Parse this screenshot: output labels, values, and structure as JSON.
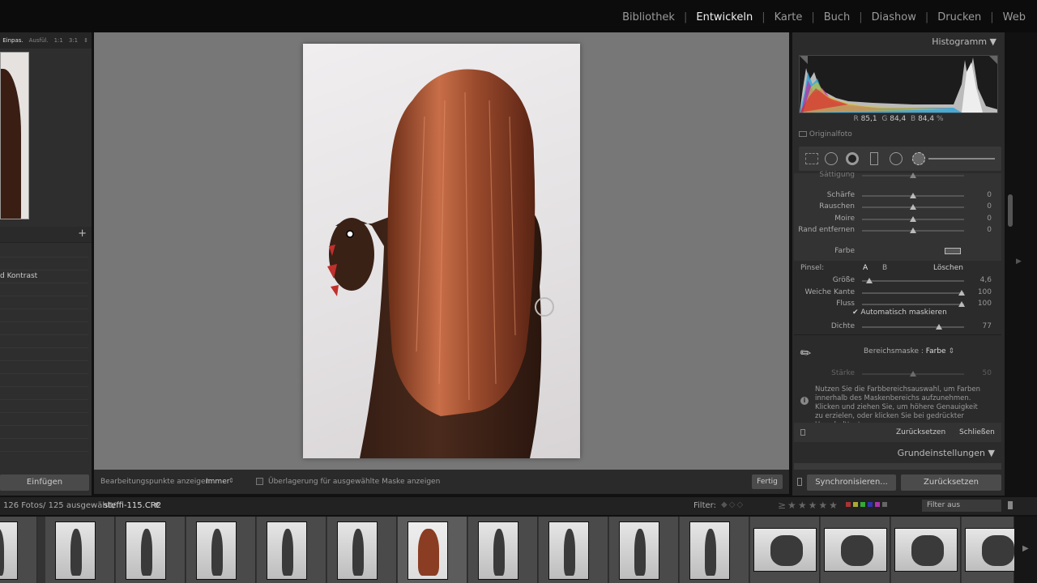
{
  "modules": [
    "Bibliothek",
    "Entwickeln",
    "Karte",
    "Buch",
    "Diashow",
    "Drucken",
    "Web"
  ],
  "active_module": "Entwickeln",
  "navigator": {
    "zoom_options": [
      "Einpas.",
      "Ausfül.",
      "1:1",
      "3:1"
    ]
  },
  "presets": {
    "items": [
      "d Kontrast"
    ]
  },
  "left_buttons": {
    "paste": "Einfügen"
  },
  "toolbar": {
    "edit_points_label": "Bearbeitungspunkte anzeigen:",
    "edit_points_value": "Immer",
    "overlay_label": "Überlagerung für ausgewählte Maske anzeigen",
    "done": "Fertig"
  },
  "histogram": {
    "title": "Histogramm",
    "r_label": "R",
    "r": "85,1",
    "g_label": "G",
    "g": "84,4",
    "b_label": "B",
    "b": "84,4",
    "unit": "%",
    "original": "Originalfoto"
  },
  "adjust": {
    "top_cut": "Sättigung",
    "rows": [
      {
        "label": "Schärfe",
        "value": "0"
      },
      {
        "label": "Rauschen",
        "value": "0"
      },
      {
        "label": "Moire",
        "value": "0"
      },
      {
        "label": "Rand entfernen",
        "value": "0"
      }
    ],
    "farbe": "Farbe"
  },
  "brush": {
    "label": "Pinsel:",
    "a": "A",
    "b": "B",
    "clear": "Löschen",
    "rows": [
      {
        "label": "Größe",
        "value": "4,6"
      },
      {
        "label": "Weiche Kante",
        "value": "100"
      },
      {
        "label": "Fluss",
        "value": "100"
      }
    ],
    "automask": "Automatisch maskieren",
    "density_label": "Dichte",
    "density_value": "77"
  },
  "range_mask": {
    "label": "Bereichsmaske :",
    "value": "Farbe",
    "amount_label": "Stärke",
    "amount_value": "50",
    "info": "Nutzen Sie die Farbbereichsauswahl, um Farben innerhalb des Maskenbereichs aufzunehmen. Klicken und ziehen Sie, um höhere Genauigkeit zu erzielen, oder klicken Sie bei gedrückter Umschalttaste, um"
  },
  "panel_buttons": {
    "reset": "Zurücksetzen",
    "close": "Schließen"
  },
  "grundeinstellungen": "Grundeinstellungen",
  "bottom_buttons": {
    "sync": "Synchronisieren...",
    "reset": "Zurücksetzen"
  },
  "filmstrip": {
    "info": "126 Fotos/ 125 ausgewählt/",
    "filename": "steffi-115.CR2",
    "filter_label": "Filter:",
    "filter_value": "Filter aus"
  },
  "colors": {
    "accent": "#f0f0f0",
    "panel": "#2b2b2b"
  }
}
